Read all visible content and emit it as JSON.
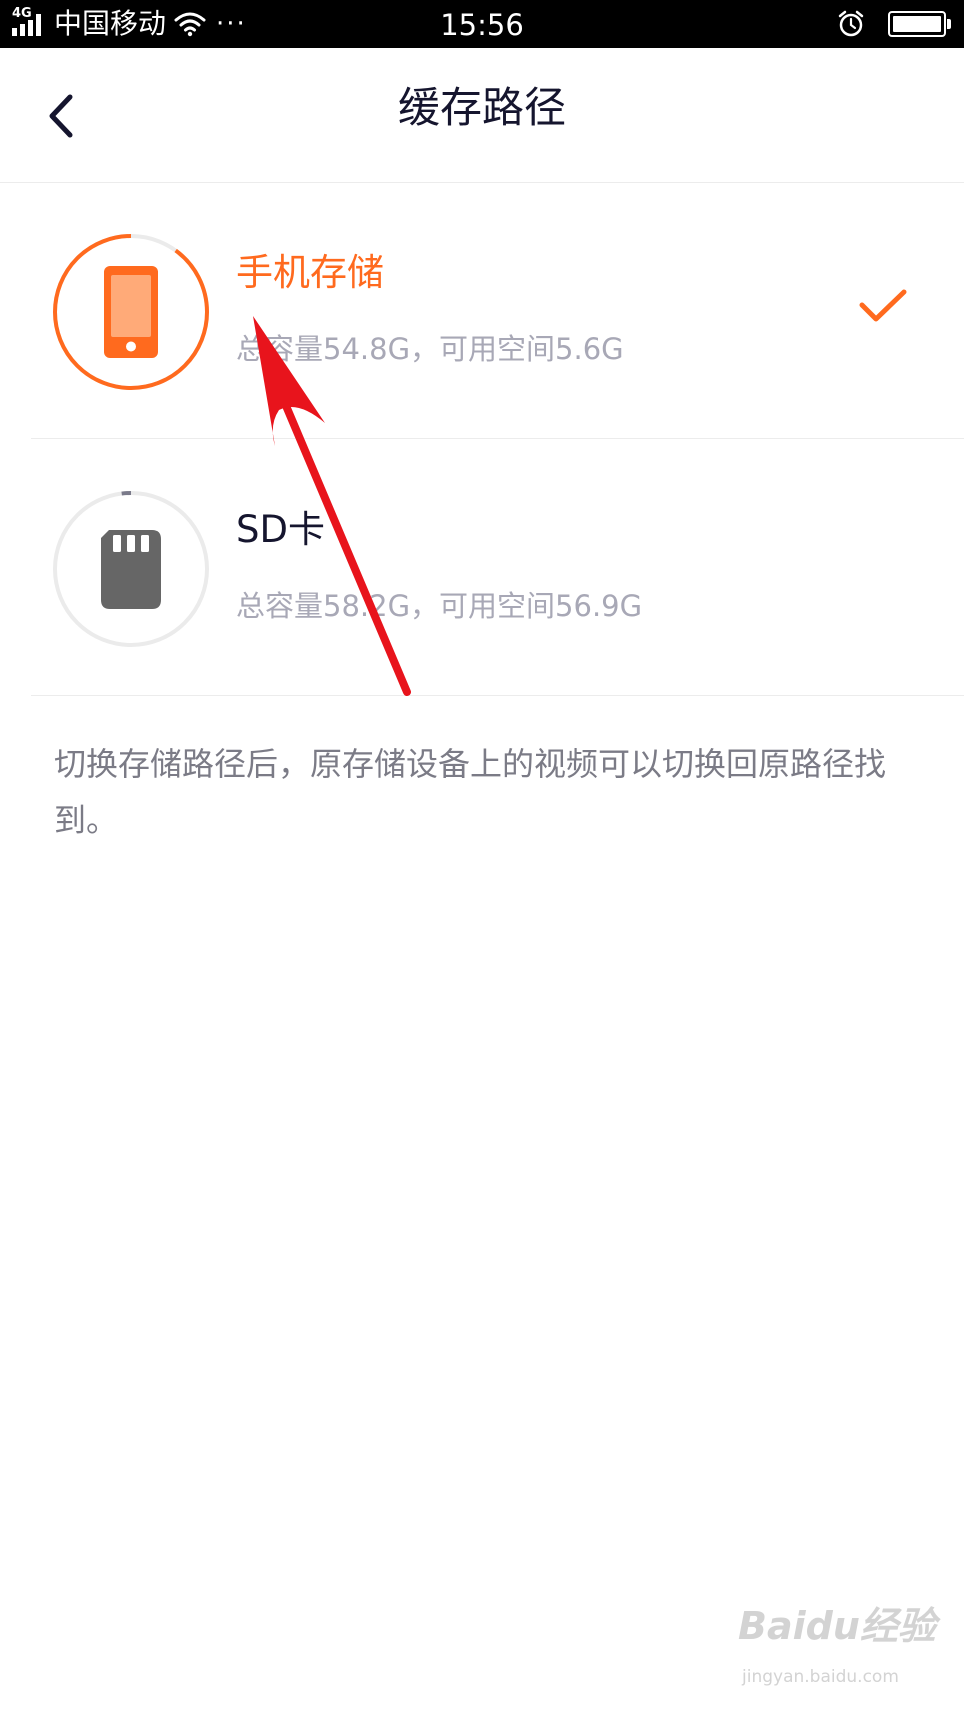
{
  "status_bar": {
    "network": "4G",
    "carrier": "中国移动",
    "more": "···",
    "time": "15:56"
  },
  "header": {
    "title": "缓存路径"
  },
  "storage_options": [
    {
      "name": "手机存储",
      "detail": "总容量54.8G，可用空间5.6G",
      "selected": true,
      "icon": "phone-icon",
      "used_fraction": 0.9
    },
    {
      "name": "SD卡",
      "detail": "总容量58.2G，可用空间56.9G",
      "selected": false,
      "icon": "sd-card-icon",
      "used_fraction": 0.02
    }
  ],
  "note": "切换存储路径后，原存储设备上的视频可以切换回原路径找到。",
  "watermark": {
    "logo": "Baidu经验",
    "url": "jingyan.baidu.com"
  },
  "colors": {
    "accent": "#ff6a1e",
    "title_text": "#15152e",
    "secondary_text": "#a8a8b6",
    "note_text": "#7b7b86",
    "annotation_arrow": "#e8141c"
  }
}
